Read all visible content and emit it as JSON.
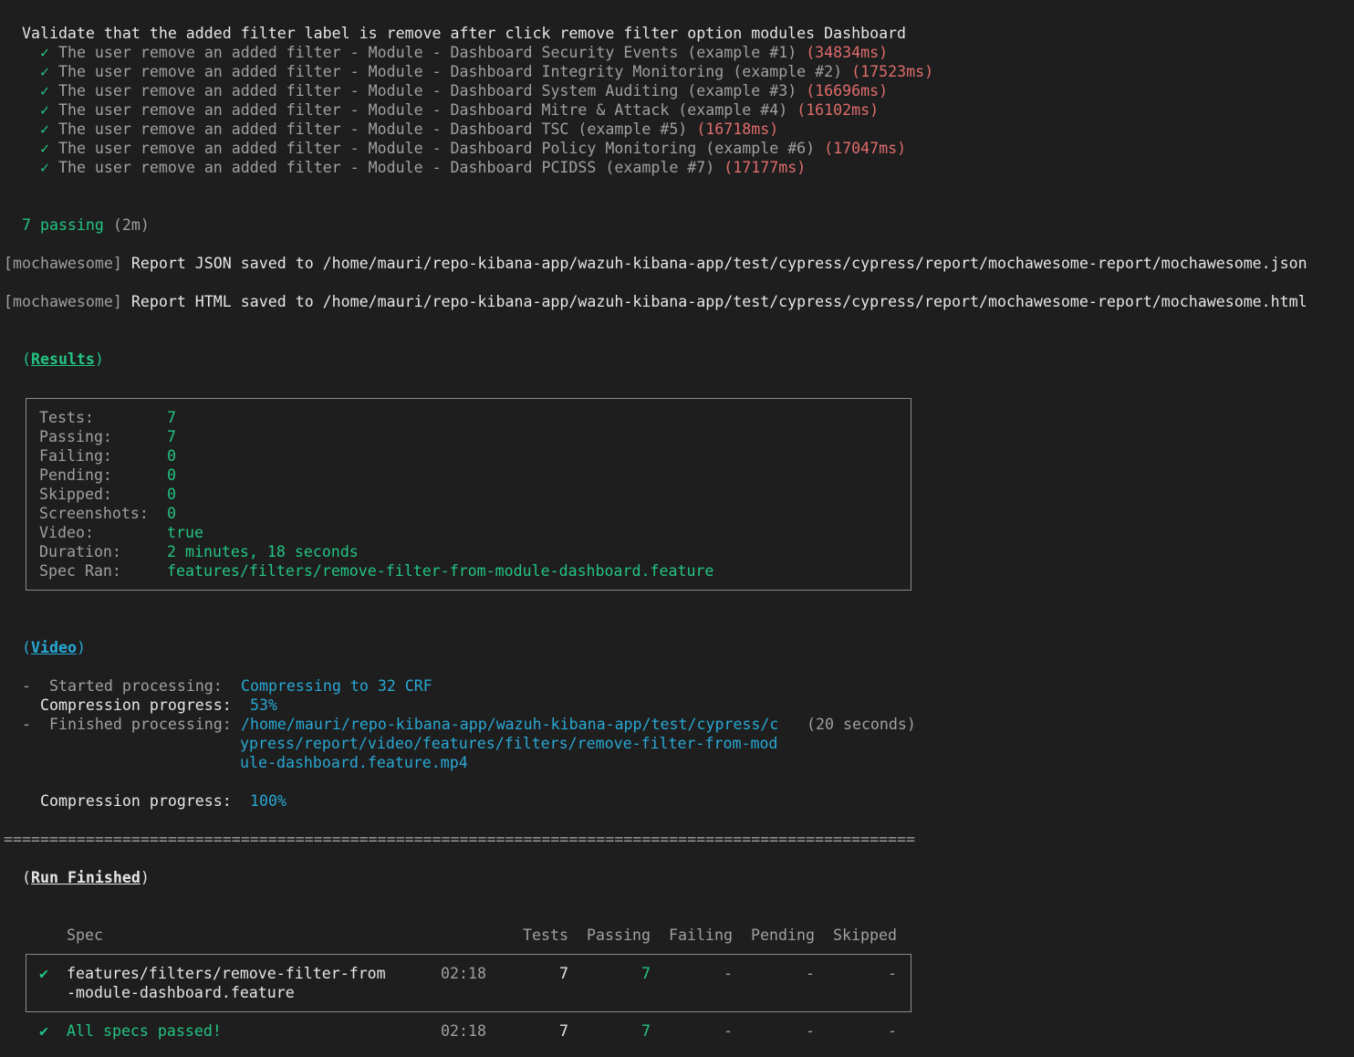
{
  "suite": {
    "title": "Validate that the added filter label is remove after click remove filter option modules Dashboard",
    "tests": [
      {
        "check": "✓",
        "label": "The user remove an added filter - Module - Dashboard Security Events (example #1)",
        "time": "(34834ms)"
      },
      {
        "check": "✓",
        "label": "The user remove an added filter - Module - Dashboard Integrity Monitoring (example #2)",
        "time": "(17523ms)"
      },
      {
        "check": "✓",
        "label": "The user remove an added filter - Module - Dashboard System Auditing (example #3)",
        "time": "(16696ms)"
      },
      {
        "check": "✓",
        "label": "The user remove an added filter - Module - Dashboard Mitre & Attack (example #4)",
        "time": "(16102ms)"
      },
      {
        "check": "✓",
        "label": "The user remove an added filter - Module - Dashboard TSC (example #5)",
        "time": "(16718ms)"
      },
      {
        "check": "✓",
        "label": "The user remove an added filter - Module - Dashboard Policy Monitoring (example #6)",
        "time": "(17047ms)"
      },
      {
        "check": "✓",
        "label": "The user remove an added filter - Module - Dashboard PCIDSS (example #7)",
        "time": "(17177ms)"
      }
    ],
    "passing": "7 passing",
    "passing_time": "(2m)"
  },
  "mochawesome": {
    "tag": "[mochawesome]",
    "json_msg": "Report JSON saved to /home/mauri/repo-kibana-app/wazuh-kibana-app/test/cypress/cypress/report/mochawesome-report/mochawesome.json",
    "html_msg": "Report HTML saved to /home/mauri/repo-kibana-app/wazuh-kibana-app/test/cypress/cypress/report/mochawesome-report/mochawesome.html"
  },
  "results": {
    "heading": "Results",
    "rows": [
      {
        "key": "Tests:",
        "value": "7"
      },
      {
        "key": "Passing:",
        "value": "7"
      },
      {
        "key": "Failing:",
        "value": "0"
      },
      {
        "key": "Pending:",
        "value": "0"
      },
      {
        "key": "Skipped:",
        "value": "0"
      },
      {
        "key": "Screenshots:",
        "value": "0"
      },
      {
        "key": "Video:",
        "value": "true"
      },
      {
        "key": "Duration:",
        "value": "2 minutes, 18 seconds"
      },
      {
        "key": "Spec Ran:",
        "value": "features/filters/remove-filter-from-module-dashboard.feature"
      }
    ]
  },
  "video": {
    "heading": "Video",
    "dash": "-",
    "started_label": "Started processing:",
    "started_value": "Compressing to 32 CRF",
    "progress_label": "Compression progress:",
    "progress_1": "53%",
    "finished_label": "Finished processing:",
    "finished_path_lines": [
      "/home/mauri/repo-kibana-app/wazuh-kibana-app/test/cypress/c",
      "ypress/report/video/features/filters/remove-filter-from-mod",
      "ule-dashboard.feature.mp4"
    ],
    "finished_time": "(20 seconds)",
    "progress_2": "100%"
  },
  "separator": "====================================================================================================",
  "run_finished": {
    "heading": "Run Finished",
    "columns": [
      "Spec",
      "Tests",
      "Passing",
      "Failing",
      "Pending",
      "Skipped"
    ],
    "spec_row": {
      "check": "✔",
      "spec_line1": "features/filters/remove-filter-from",
      "spec_line2": "-module-dashboard.feature",
      "duration": "02:18",
      "tests": "7",
      "passing": "7",
      "failing": "-",
      "pending": "-",
      "skipped": "-"
    },
    "total_row": {
      "check": "✔",
      "label": "All specs passed!",
      "duration": "02:18",
      "tests": "7",
      "passing": "7",
      "failing": "-",
      "pending": "-",
      "skipped": "-"
    }
  }
}
